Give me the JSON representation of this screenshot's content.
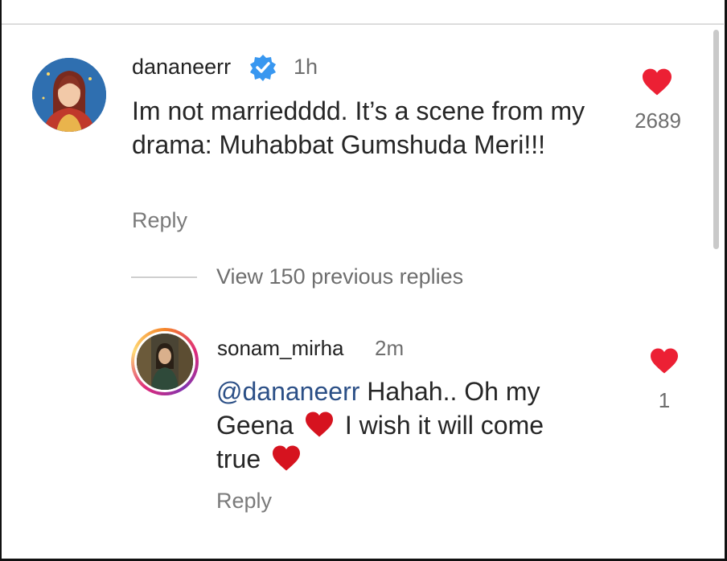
{
  "comment": {
    "username": "dananeerr",
    "time": "1h",
    "text": "Im not marriedddd. It’s a scene from my drama: Muhabbat Gumshuda Meri!!!",
    "reply_label": "Reply",
    "like_count": "2689"
  },
  "view_replies": "View 150 previous replies",
  "reply": {
    "username": "sonam_mirha",
    "time": "2m",
    "mention": "@dananeerr",
    "text_part1": " Hahah.. Oh my Geena",
    "text_part2": " I wish it will come true",
    "reply_label": "Reply",
    "like_count": "1"
  },
  "icons": {
    "verified": "verified-badge-icon",
    "like": "heart-icon",
    "emoji": "red-heart-emoji"
  },
  "colors": {
    "like_red": "#ec2034",
    "verified_blue": "#3897f0",
    "mention_blue": "#2b4f86"
  }
}
